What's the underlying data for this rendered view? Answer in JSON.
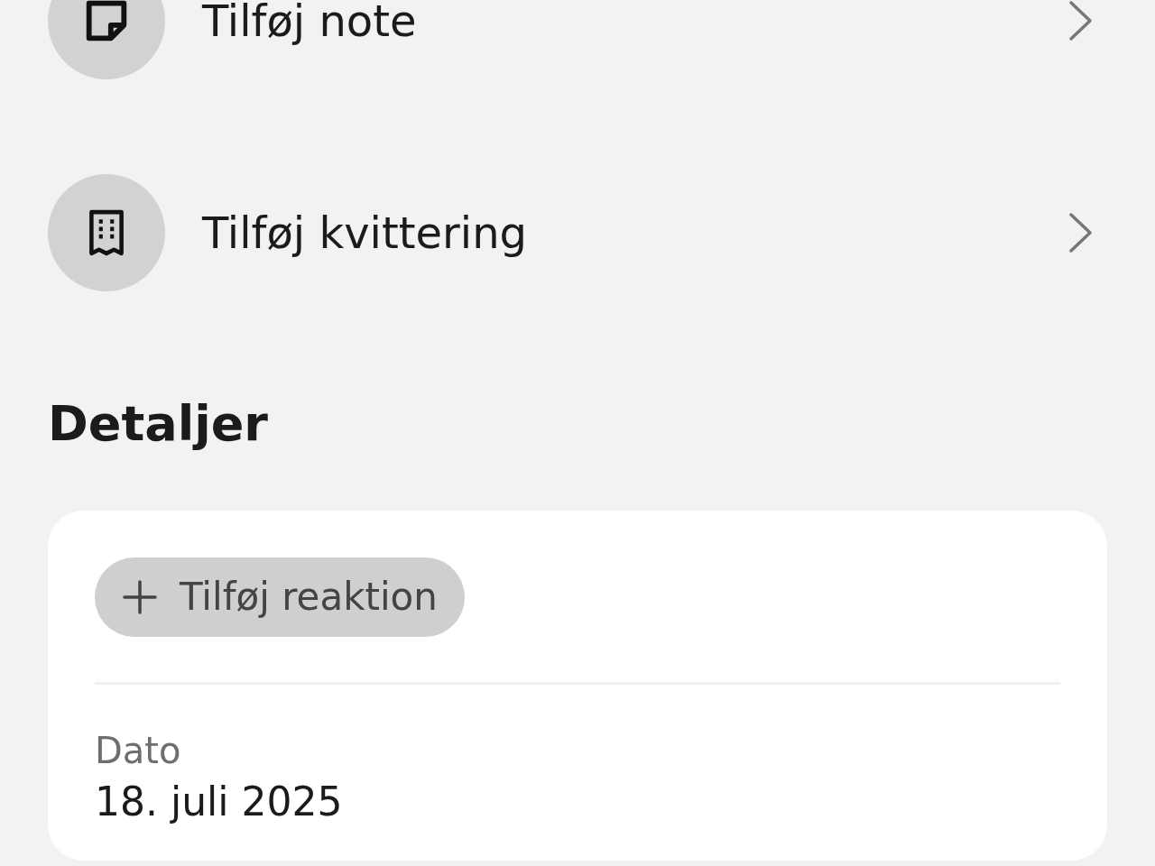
{
  "actions": [
    {
      "kind": "note",
      "label": "Tilføj note"
    },
    {
      "kind": "receipt",
      "label": "Tilføj kvittering"
    }
  ],
  "details": {
    "title": "Detaljer",
    "reaction_button": "Tilføj reaktion",
    "fields": [
      {
        "label": "Dato",
        "value": "18. juli 2025"
      }
    ]
  }
}
